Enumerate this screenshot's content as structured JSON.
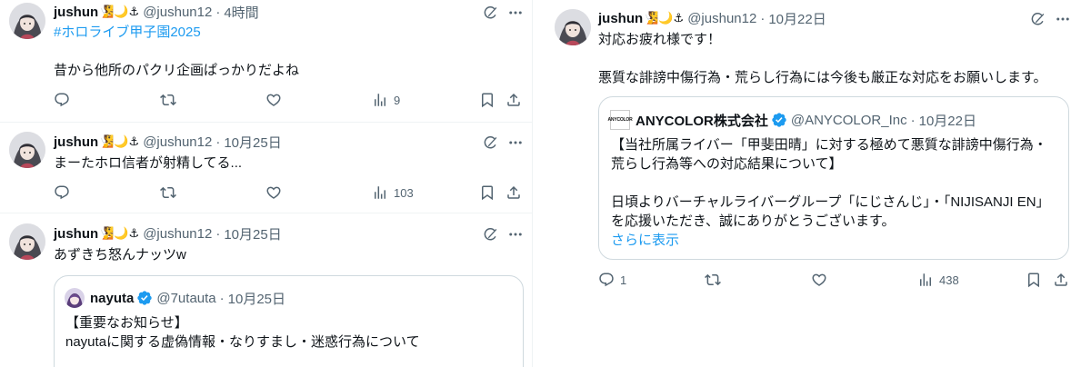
{
  "left_column": {
    "tweets": [
      {
        "author": {
          "name": "jushun",
          "emoji": [
            "🧏",
            "🌙",
            "⚓"
          ],
          "handle": "@jushun12"
        },
        "time": "4時間",
        "hashtag": "#ホロライブ甲子園2025",
        "lines": [
          "",
          "昔から他所のパクリ企画ぱっかりだよね"
        ],
        "stats": {
          "replies": "",
          "retweets": "",
          "likes": "",
          "views": "9"
        }
      },
      {
        "author": {
          "name": "jushun",
          "emoji": [
            "🧏",
            "🌙",
            "⚓"
          ],
          "handle": "@jushun12"
        },
        "time": "10月25日",
        "lines": [
          "まーたホロ信者が射精してる..."
        ],
        "stats": {
          "replies": "",
          "retweets": "",
          "likes": "",
          "views": "103"
        }
      },
      {
        "author": {
          "name": "jushun",
          "emoji": [
            "🧏",
            "🌙",
            "⚓"
          ],
          "handle": "@jushun12"
        },
        "time": "10月25日",
        "lines": [
          "あずきち怒んナッツw"
        ],
        "quote": {
          "name": "nayuta",
          "handle": "@7utauta",
          "time": "10月25日",
          "lines": [
            "【重要なお知らせ】",
            "nayutaに関する虚偽情報・なりすまし・迷惑行為について"
          ]
        }
      }
    ]
  },
  "right_column": {
    "tweet": {
      "author": {
        "name": "jushun",
        "emoji": [
          "🧏",
          "🌙",
          "⚓"
        ],
        "handle": "@jushun12"
      },
      "time": "10月22日",
      "lines": [
        "対応お疲れ様です！",
        "",
        "悪質な誹謗中傷行為・荒らし行為には今後も厳正な対応をお願いします。"
      ],
      "quote": {
        "name": "ANYCOLOR株式会社",
        "logo_text": "ANYCOLOR",
        "handle": "@ANYCOLOR_Inc",
        "time": "10月22日",
        "lines": [
          "【当社所属ライバー「甲斐田晴」に対する極めて悪質な誹謗中傷行為・",
          "荒らし行為等への対応結果について】",
          "",
          "日頃よりバーチャルライバーグループ「にじさんじ」・「NIJISANJI EN」",
          "を応援いただき、誠にありがとうございます。"
        ],
        "show_more": "さらに表示"
      },
      "stats": {
        "replies": "1",
        "retweets": "",
        "likes": "",
        "views": "438"
      }
    }
  },
  "icons": [
    "grok-icon",
    "more-icon",
    "reply-icon",
    "retweet-icon",
    "like-icon",
    "views-icon",
    "bookmark-icon",
    "share-icon",
    "verified-badge-icon"
  ],
  "colors": {
    "accent": "#1d9bf0",
    "secondary_text": "#536471",
    "border": "#cfd9de",
    "divider": "#eff3f4"
  }
}
